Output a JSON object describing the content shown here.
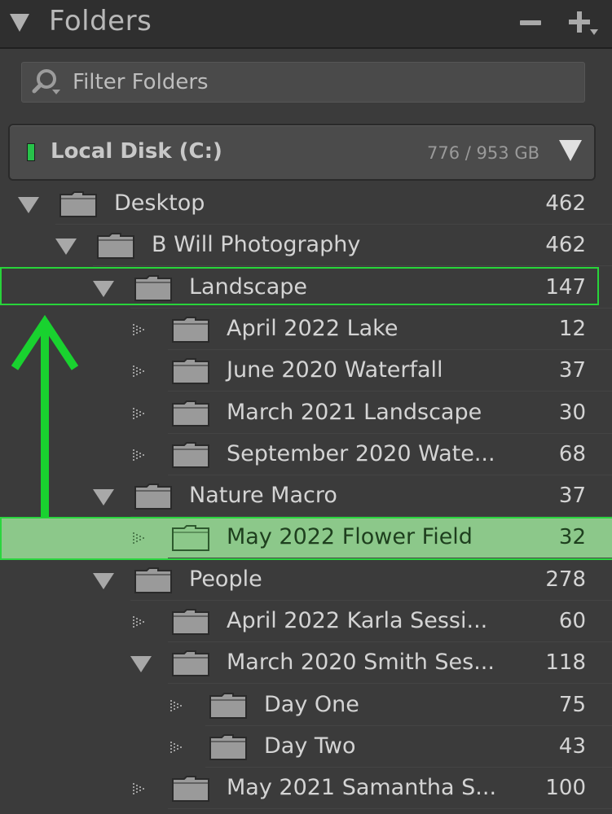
{
  "panel": {
    "title": "Folders",
    "colors": {
      "panel_bg": "#3b3b3b",
      "highlight": "#2bd53f",
      "selected_bg": "#8cc88a"
    }
  },
  "filter": {
    "placeholder": "Filter Folders"
  },
  "disk": {
    "name": "Local Disk (C:)",
    "usage": "776 / 953 GB",
    "status_color": "#27c24a"
  },
  "folders": [
    {
      "name": "Desktop",
      "count": "462",
      "depth": 0,
      "expander": "open"
    },
    {
      "name": "B Will Photography",
      "count": "462",
      "depth": 1,
      "expander": "open"
    },
    {
      "name": "Landscape",
      "count": "147",
      "depth": 2,
      "expander": "open",
      "outlined": true
    },
    {
      "name": "April 2022 Lake",
      "count": "12",
      "depth": 3,
      "expander": "closed"
    },
    {
      "name": "June 2020 Waterfall",
      "count": "37",
      "depth": 3,
      "expander": "closed"
    },
    {
      "name": "March 2021 Landscape",
      "count": "30",
      "depth": 3,
      "expander": "closed"
    },
    {
      "name": "September 2020 Wate...",
      "count": "68",
      "depth": 3,
      "expander": "closed"
    },
    {
      "name": "Nature Macro",
      "count": "37",
      "depth": 2,
      "expander": "open"
    },
    {
      "name": "May 2022 Flower Field",
      "count": "32",
      "depth": 3,
      "expander": "closed",
      "selected": true
    },
    {
      "name": "People",
      "count": "278",
      "depth": 2,
      "expander": "open"
    },
    {
      "name": "April 2022 Karla Sessi...",
      "count": "60",
      "depth": 3,
      "expander": "closed"
    },
    {
      "name": "March 2020 Smith Ses...",
      "count": "118",
      "depth": 3,
      "expander": "open"
    },
    {
      "name": "Day One",
      "count": "75",
      "depth": 4,
      "expander": "closed"
    },
    {
      "name": "Day Two",
      "count": "43",
      "depth": 4,
      "expander": "closed"
    },
    {
      "name": "May 2021 Samantha S...",
      "count": "100",
      "depth": 3,
      "expander": "closed"
    }
  ]
}
